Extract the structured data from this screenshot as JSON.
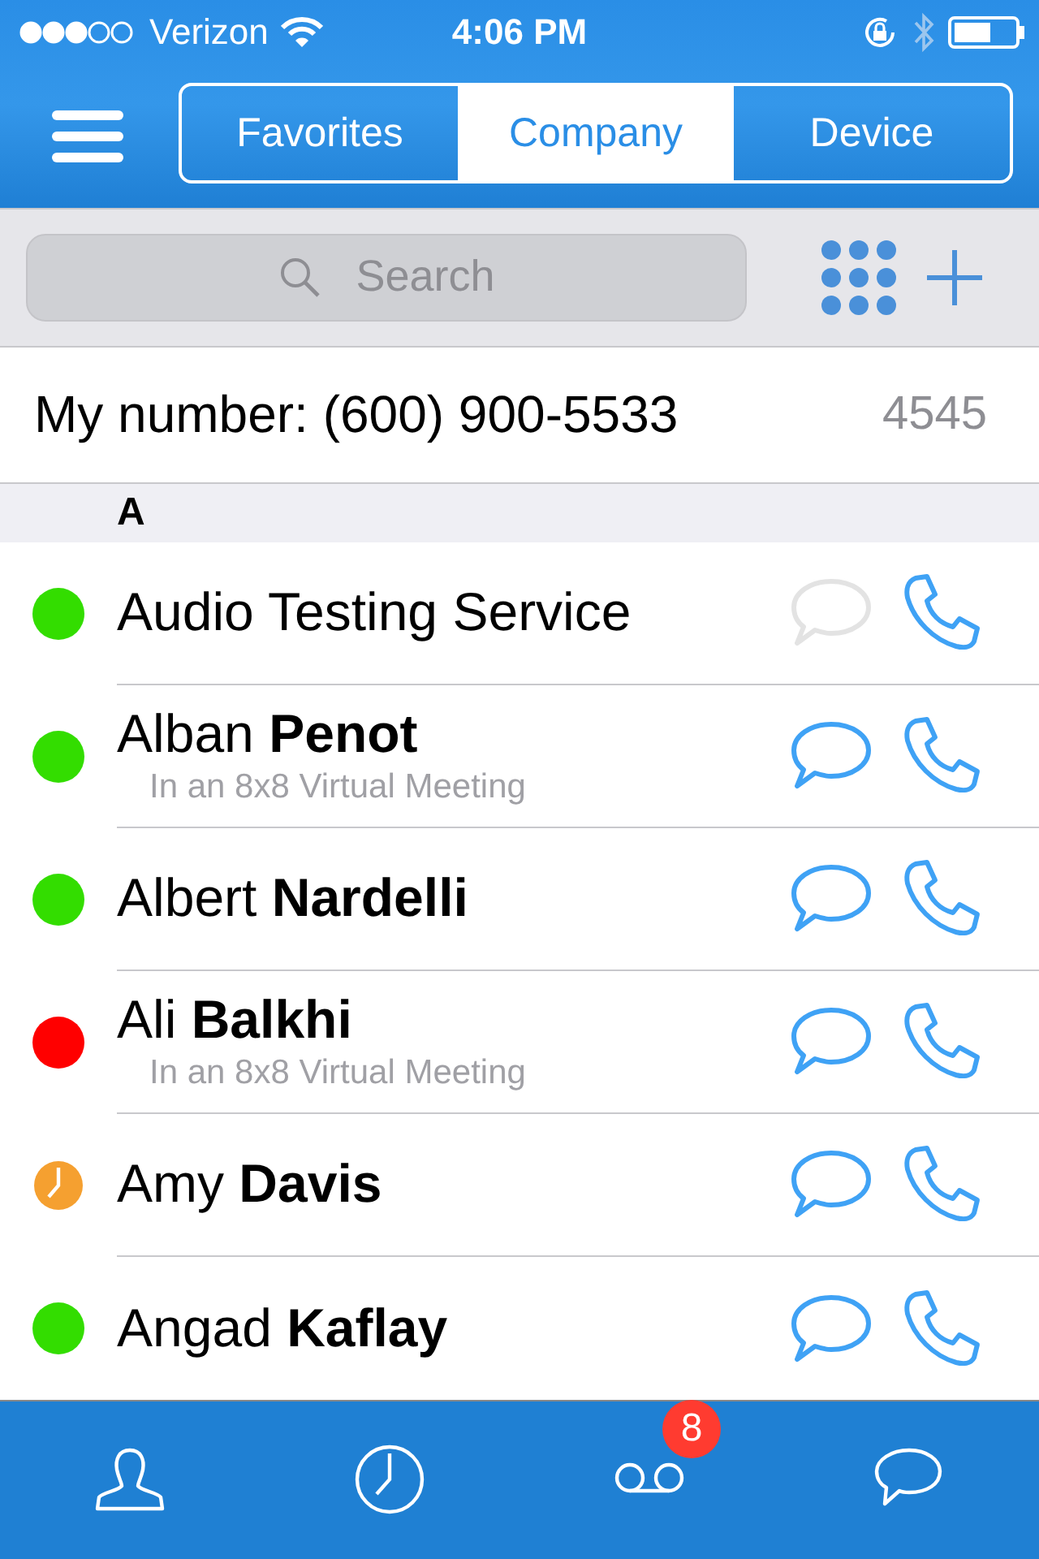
{
  "status_bar": {
    "carrier": "Verizon",
    "time": "4:06 PM"
  },
  "tabs": [
    {
      "label": "Favorites",
      "selected": false
    },
    {
      "label": "Company",
      "selected": true
    },
    {
      "label": "Device",
      "selected": false
    }
  ],
  "search": {
    "placeholder": "Search"
  },
  "my_number": {
    "label": "My number: (600) 900-5533",
    "extension": "4545"
  },
  "section": "A",
  "contacts": [
    {
      "name": "Audio Testing Service",
      "kind": "available",
      "color": "#33dd00",
      "chat_enabled": false
    },
    {
      "name": "Alban **Penot**",
      "subtitle": "In an 8x8 Virtual Meeting",
      "kind": "available",
      "color": "#33dd00",
      "chat_enabled": true
    },
    {
      "name": "Albert **Nardelli**",
      "kind": "available",
      "color": "#33dd00",
      "chat_enabled": true
    },
    {
      "name": "Ali **Balkhi**",
      "subtitle": "In an 8x8 Virtual Meeting",
      "kind": "busy",
      "color": "#ff0000",
      "chat_enabled": true
    },
    {
      "name": "Amy **Davis**",
      "kind": "away",
      "color": "#f5a030",
      "chat_enabled": true
    },
    {
      "name": "Angad **Kaflay**",
      "kind": "available",
      "color": "#33dd00",
      "chat_enabled": true
    }
  ],
  "tab_bar": {
    "voicemail_badge": "8"
  }
}
